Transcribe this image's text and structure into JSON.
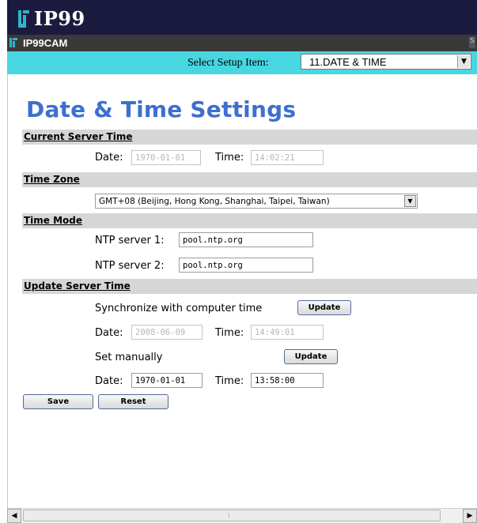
{
  "banner": {
    "brand": "IP99"
  },
  "subbar": {
    "title": "IP99CAM",
    "corner": "S"
  },
  "setup_selector": {
    "label": "Select Setup Item:",
    "selected": "11.DATE & TIME"
  },
  "page_title": "Date & Time Settings",
  "current_server_time": {
    "heading": "Current Server Time",
    "date_label": "Date:",
    "date_value": "1970-01-01",
    "time_label": "Time:",
    "time_value": "14:02:21"
  },
  "time_zone": {
    "heading": "Time Zone",
    "selected": "GMT+08 (Beijing, Hong Kong, Shanghai, Taipei, Taiwan)"
  },
  "time_mode": {
    "heading": "Time Mode",
    "ntp1_label": "NTP server 1:",
    "ntp1_value": "pool.ntp.org",
    "ntp2_label": "NTP server 2:",
    "ntp2_value": "pool.ntp.org"
  },
  "update_server_time": {
    "heading": "Update Server Time",
    "sync_label": "Synchronize with computer time",
    "sync_button": "Update",
    "sync_date_label": "Date:",
    "sync_date_value": "2008-06-09",
    "sync_time_label": "Time:",
    "sync_time_value": "14:49:01",
    "manual_label": "Set manually",
    "manual_button": "Update",
    "manual_date_label": "Date:",
    "manual_date_value": "1970-01-01",
    "manual_time_label": "Time:",
    "manual_time_value": "13:58:00"
  },
  "actions": {
    "save": "Save",
    "reset": "Reset"
  },
  "scrollbar": {
    "grip": "⁞"
  }
}
